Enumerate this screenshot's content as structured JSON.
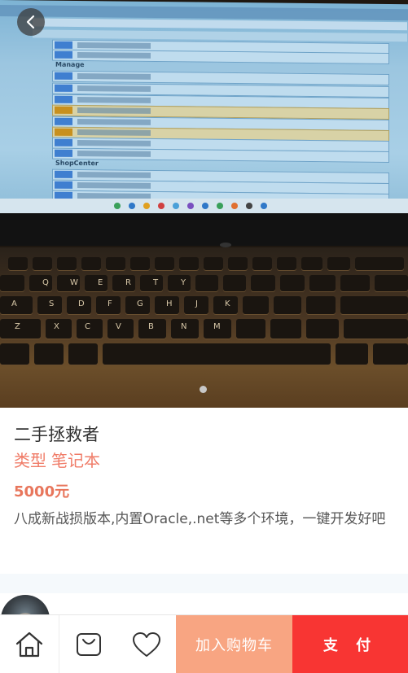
{
  "product": {
    "title": "二手拯救者",
    "category_label": "类型",
    "category_value": "笔记本",
    "price": "5000元",
    "description": "八成新战损版本,内置Oracle,.net等多个环境，一键开发好吧"
  },
  "photo": {
    "subject": "laptop showing API documentation page",
    "screen_sections": [
      "Manage",
      "ShopCenter"
    ],
    "http_methods": [
      "GET",
      "GET",
      "GET",
      "GET",
      "GET",
      "PUT",
      "GET",
      "PUT",
      "GET",
      "GET",
      "GET",
      "GET",
      "GET"
    ],
    "carousel_pages": 1
  },
  "icons": {
    "back": "chevron-left-icon",
    "home": "home-icon",
    "cart": "shopping-bag-icon",
    "favorite": "heart-icon"
  },
  "actions": {
    "add_to_cart": "加入购物车",
    "pay": "支 付"
  },
  "colors": {
    "accent_text": "#f07c68",
    "price": "#e8765c",
    "add_to_cart_bg": "#f8a582",
    "pay_bg": "#f83533"
  }
}
